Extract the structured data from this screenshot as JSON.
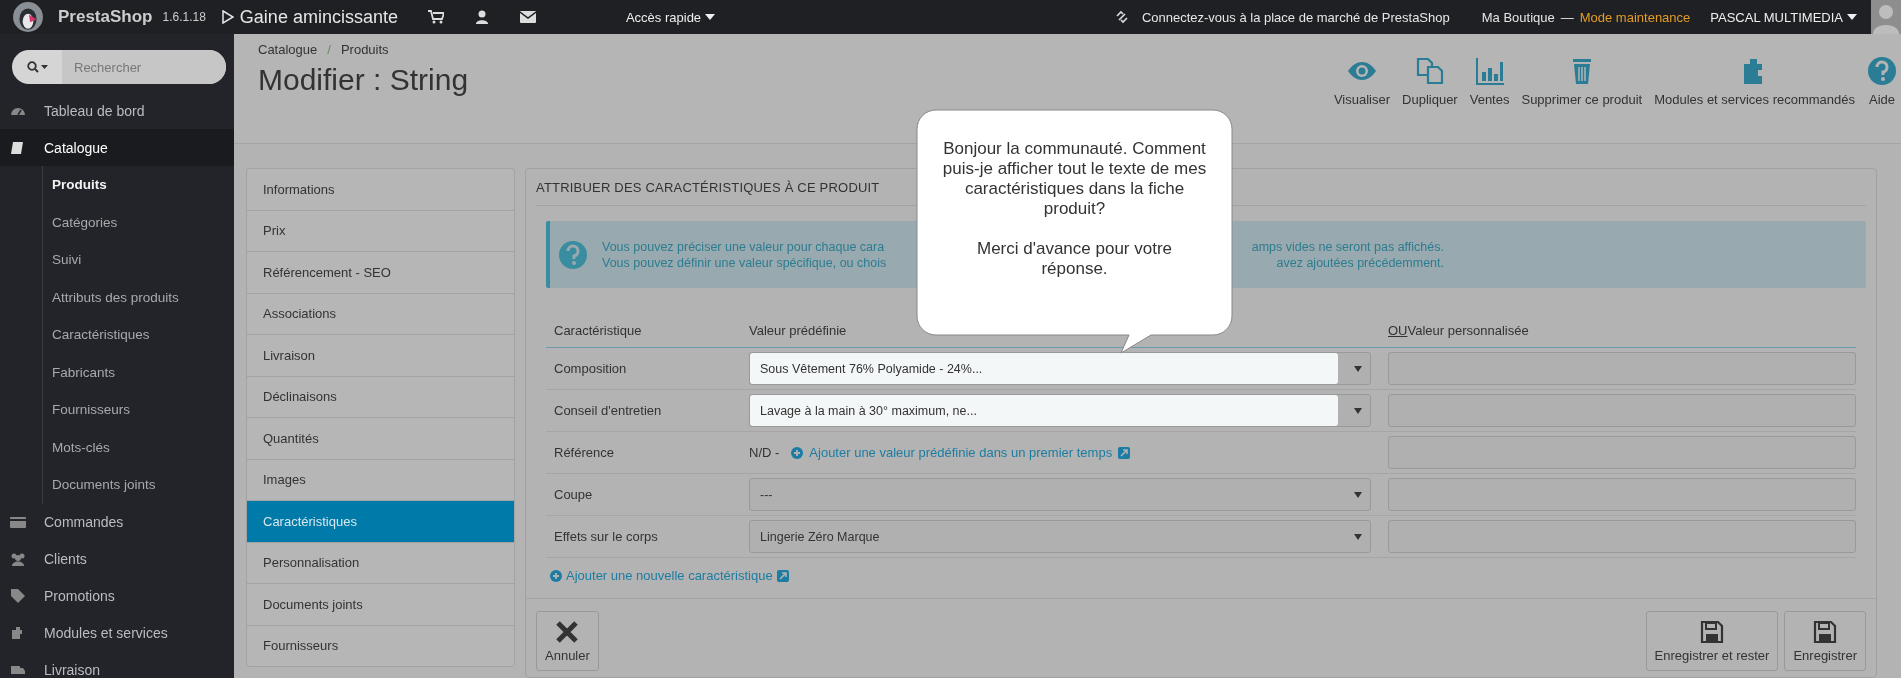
{
  "topbar": {
    "brand": "PrestaShop",
    "version": "1.6.1.18",
    "shop_link": "Gaine amincissante",
    "quick_access": "Accès rapide",
    "marketplace": "Connectez-vous à la place de marché de PrestaShop",
    "shop_name": "Ma Boutique",
    "separator": "—",
    "mode": "Mode maintenance",
    "user": "PASCAL MULTIMEDIA"
  },
  "sidebar": {
    "search": {
      "placeholder": "Rechercher"
    },
    "items": [
      {
        "label": "Tableau de bord",
        "selected": false
      },
      {
        "label": "Catalogue",
        "selected": true,
        "children": [
          {
            "label": "Produits",
            "selected": true
          },
          {
            "label": "Catégories",
            "selected": false
          },
          {
            "label": "Suivi",
            "selected": false
          },
          {
            "label": "Attributs des produits",
            "selected": false
          },
          {
            "label": "Caractéristiques",
            "selected": false
          },
          {
            "label": "Fabricants",
            "selected": false
          },
          {
            "label": "Fournisseurs",
            "selected": false
          },
          {
            "label": "Mots-clés",
            "selected": false
          },
          {
            "label": "Documents joints",
            "selected": false
          }
        ]
      },
      {
        "label": "Commandes",
        "selected": false
      },
      {
        "label": "Clients",
        "selected": false
      },
      {
        "label": "Promotions",
        "selected": false
      },
      {
        "label": "Modules et services",
        "selected": false
      },
      {
        "label": "Livraison",
        "selected": false
      }
    ]
  },
  "header": {
    "breadcrumb": [
      "Catalogue",
      "Produits"
    ],
    "breadcrumb_separator": "/",
    "title": "Modifier : String",
    "toolbar": [
      {
        "label": "Visualiser"
      },
      {
        "label": "Dupliquer"
      },
      {
        "label": "Ventes"
      },
      {
        "label": "Supprimer ce produit"
      },
      {
        "label": "Modules et services recommandés"
      },
      {
        "label": "Aide"
      }
    ]
  },
  "product_tabs": [
    {
      "label": "Informations",
      "selected": false
    },
    {
      "label": "Prix",
      "selected": false
    },
    {
      "label": "Référencement - SEO",
      "selected": false
    },
    {
      "label": "Associations",
      "selected": false
    },
    {
      "label": "Livraison",
      "selected": false
    },
    {
      "label": "Déclinaisons",
      "selected": false
    },
    {
      "label": "Quantités",
      "selected": false
    },
    {
      "label": "Images",
      "selected": false
    },
    {
      "label": "Caractéristiques",
      "selected": true
    },
    {
      "label": "Personnalisation",
      "selected": false
    },
    {
      "label": "Documents joints",
      "selected": false
    },
    {
      "label": "Fournisseurs",
      "selected": false
    }
  ],
  "panel": {
    "title": "ATTRIBUER DES CARACTÉRISTIQUES À CE PRODUIT",
    "info_lines": [
      {
        "left": "Vous pouvez préciser une valeur pour chaque cara",
        "right": "amps vides ne seront pas affichés."
      },
      {
        "left": "Vous pouvez définir une valeur spécifique, ou chois",
        "right": "avez ajoutées précédemment."
      }
    ],
    "columns": [
      "Caractéristique",
      "Valeur prédéfinie"
    ],
    "custom_column": {
      "prefix": "OU",
      "label": "Valeur personnalisée"
    },
    "rows": [
      {
        "kind": "select",
        "label": "Composition",
        "value": "Sous Vêtement 76% Polyamide - 24%...",
        "highlighted": true
      },
      {
        "kind": "select",
        "label": "Conseil d'entretien",
        "value": "Lavage à la main à 30° maximum, ne...",
        "highlighted": true
      },
      {
        "kind": "reference",
        "label": "Référence",
        "note": "N/D -",
        "link": "Ajouter une valeur prédéfinie dans un premier temps"
      },
      {
        "kind": "select",
        "label": "Coupe",
        "value": "---",
        "highlighted": false
      },
      {
        "kind": "select",
        "label": "Effets sur le corps",
        "value": "Lingerie Zéro Marque",
        "highlighted": false
      }
    ],
    "add_link": "Ajouter une nouvelle caractéristique",
    "buttons": [
      {
        "label": "Annuler",
        "kind": "cancel"
      },
      {
        "label": "Enregistrer et rester",
        "kind": "save"
      },
      {
        "label": "Enregistrer",
        "kind": "save"
      }
    ]
  },
  "bubble": {
    "paragraphs": [
      "Bonjour la communauté. Comment puis-je afficher tout le texte de mes caractéristiques dans la fiche produit?",
      "Merci d'avance pour votre réponse."
    ]
  }
}
